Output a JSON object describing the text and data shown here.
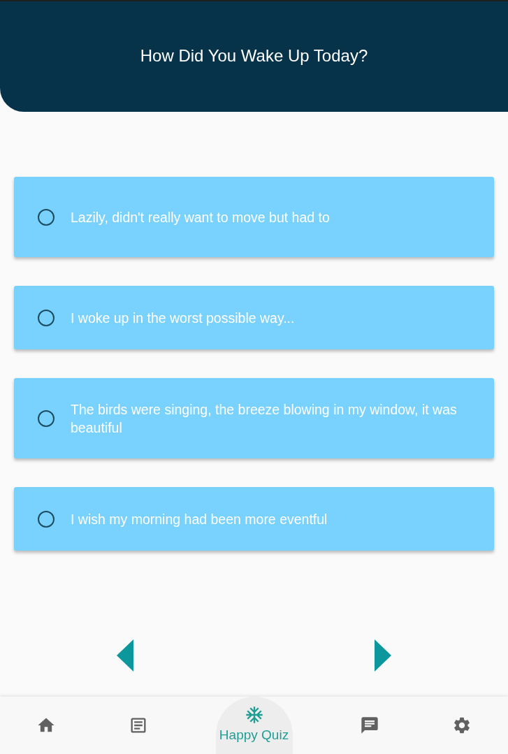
{
  "header": {
    "title": "How Did You Wake Up Today?"
  },
  "options": [
    {
      "text": "Lazily, didn't really want to move but had to",
      "selected": false
    },
    {
      "text": "I woke up in the worst possible way...",
      "selected": false
    },
    {
      "text": "The birds were singing, the breeze blowing in my window, it was beautiful",
      "selected": false
    },
    {
      "text": "I wish my morning had been more eventful",
      "selected": false
    }
  ],
  "bottom_nav": {
    "items": [
      {
        "selected": false
      },
      {
        "selected": false
      },
      {
        "label": "Happy Quiz",
        "selected": true
      },
      {
        "selected": false
      },
      {
        "selected": false
      }
    ]
  }
}
